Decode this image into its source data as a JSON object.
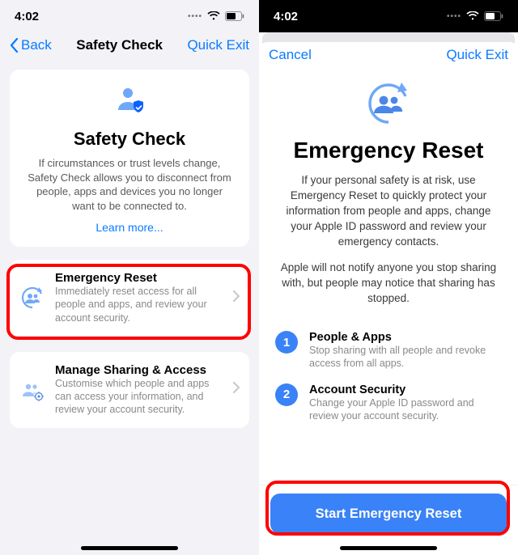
{
  "status": {
    "time": "4:02"
  },
  "left": {
    "nav": {
      "back": "Back",
      "title": "Safety Check",
      "quick_exit": "Quick Exit"
    },
    "intro": {
      "title": "Safety Check",
      "desc": "If circumstances or trust levels change, Safety Check allows you to disconnect from people, apps and devices you no longer want to be connected to.",
      "learn_more": "Learn more..."
    },
    "emergency": {
      "title": "Emergency Reset",
      "desc": "Immediately reset access for all people and apps, and review your account security."
    },
    "manage": {
      "title": "Manage Sharing & Access",
      "desc": "Customise which people and apps can access your information, and review your account security."
    }
  },
  "right": {
    "nav": {
      "cancel": "Cancel",
      "quick_exit": "Quick Exit"
    },
    "title": "Emergency Reset",
    "desc1": "If your personal safety is at risk, use Emergency Reset to quickly protect your information from people and apps, change your Apple ID password and review your emergency contacts.",
    "desc2": "Apple will not notify anyone you stop sharing with, but people may notice that sharing has stopped.",
    "steps": [
      {
        "n": "1",
        "title": "People & Apps",
        "desc": "Stop sharing with all people and revoke access from all apps."
      },
      {
        "n": "2",
        "title": "Account Security",
        "desc": "Change your Apple ID password and review your account security."
      }
    ],
    "cta": "Start Emergency Reset"
  }
}
